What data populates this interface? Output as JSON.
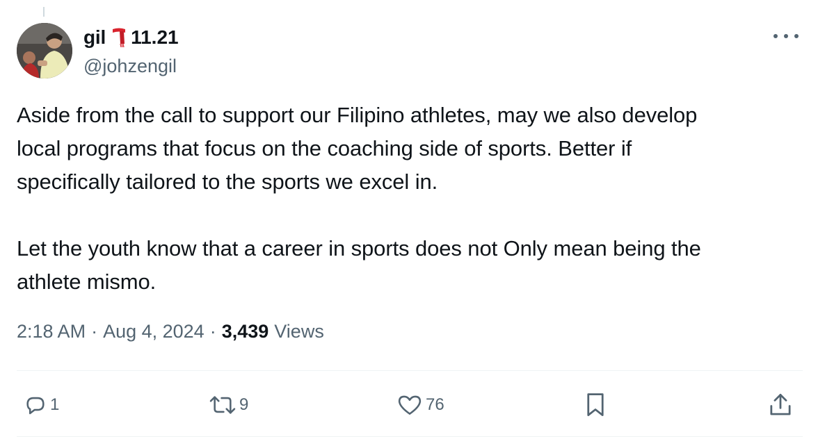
{
  "tweet": {
    "author": {
      "display_name": "gil",
      "name_suffix": "11.21",
      "handle": "@johzengil"
    },
    "text_paragraphs": [
      [
        "Aside from the call to support our Filipino athletes, may we also develop",
        "local programs that focus on the coaching side of sports. Better if",
        "specifically tailored to the sports we excel in."
      ],
      [
        "Let the youth know that a career in sports does not Only mean being the",
        "athlete mismo."
      ]
    ],
    "time": "2:18 AM",
    "date": "Aug 4, 2024",
    "separator": "·",
    "views_count": "3,439",
    "views_label": "Views"
  },
  "actions": {
    "reply_count": "1",
    "retweet_count": "9",
    "like_count": "76"
  },
  "icons": {
    "name_emoji": "scarf-icon",
    "more": "more-options-icon",
    "reply": "reply-icon",
    "retweet": "retweet-icon",
    "like": "heart-icon",
    "bookmark": "bookmark-icon",
    "share": "share-icon"
  },
  "colors": {
    "text_primary": "#0f1419",
    "text_secondary": "#536471",
    "divider": "#eff3f4",
    "scarf": "#d9242e"
  }
}
